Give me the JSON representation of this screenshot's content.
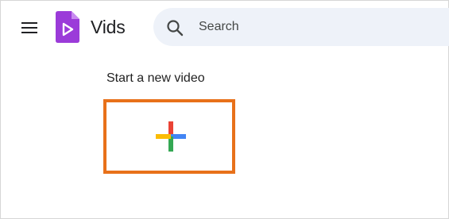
{
  "header": {
    "menu_icon": "hamburger-menu-icon",
    "logo_icon": "vids-logo-icon",
    "app_title": "Vids",
    "search": {
      "icon": "search-icon",
      "placeholder": "Search",
      "value": ""
    }
  },
  "main": {
    "section_title": "Start a new video",
    "new_video_card": {
      "icon": "plus-icon",
      "accent": "#e8711a"
    }
  },
  "colors": {
    "logo_purple": "#9b3bd9",
    "search_bg": "#eef2f9",
    "highlight_border": "#e8711a",
    "plus_red": "#ea4335",
    "plus_blue": "#4285f4",
    "plus_green": "#34a853",
    "plus_yellow": "#fbbc04"
  }
}
